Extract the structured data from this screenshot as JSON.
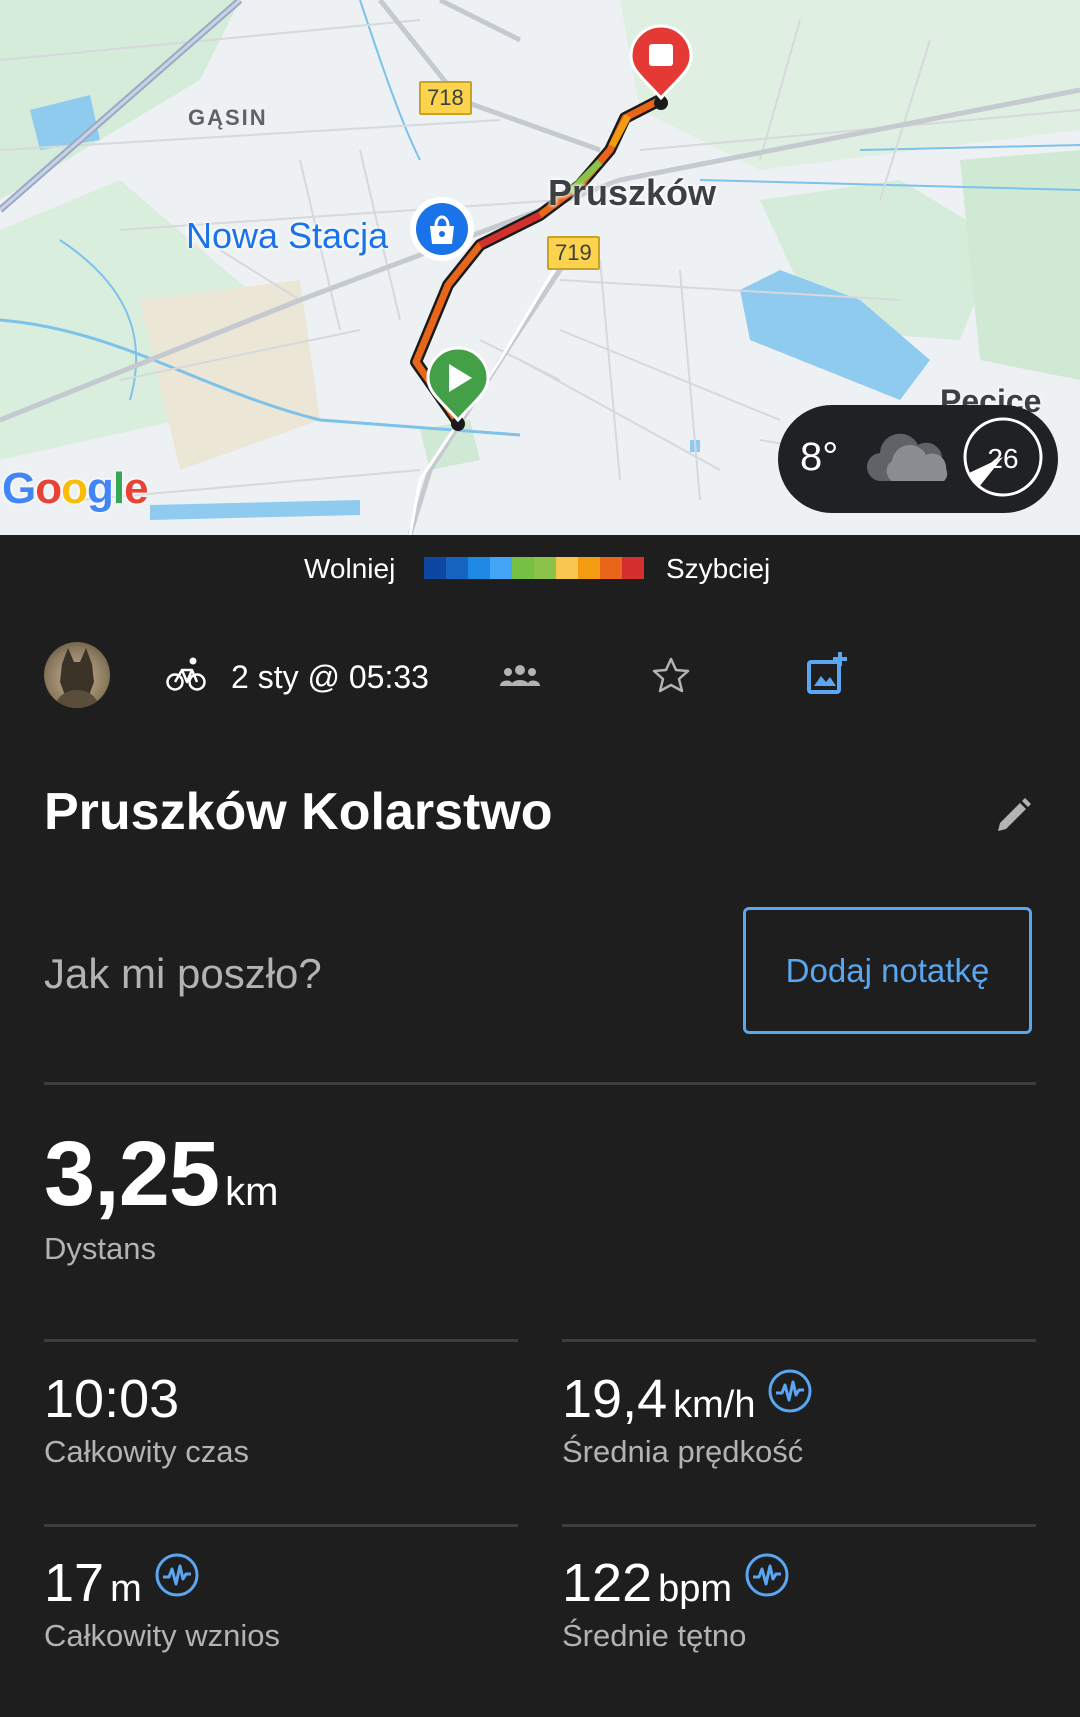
{
  "map": {
    "district_label": "GĄSIN",
    "city_label": "Pruszków",
    "poi_label": "Nowa Stacja",
    "edge_label": "Pęcice",
    "road_shields": [
      "718",
      "719"
    ],
    "logo_text": "Google",
    "weather": {
      "temperature": "8°",
      "condition_icon": "cloud-icon",
      "wind_value": "26"
    },
    "colors": {
      "route_slow": "#1565c0",
      "route_fast": "#d32f2f",
      "start_pin": "#43a047",
      "end_pin": "#e53935",
      "poi_pin": "#1a73e8"
    }
  },
  "legend": {
    "slow_label": "Wolniej",
    "fast_label": "Szybciej",
    "colors": [
      "#0d47a1",
      "#1565c0",
      "#1e88e5",
      "#42a5f5",
      "#76c043",
      "#8bc34a",
      "#f9c74f",
      "#f39c12",
      "#e8651a",
      "#d32f2f"
    ]
  },
  "activity": {
    "avatar_icon": "avatar",
    "sport_icon": "bike-icon",
    "date": "2 sty @ 05:33",
    "title": "Pruszków Kolarstwo",
    "note_prompt": "Jak mi poszło?",
    "add_note_label": "Dodaj notatkę",
    "accent_color": "#5aa6f0"
  },
  "stats": {
    "distance": {
      "value": "3,25",
      "unit": "km",
      "label": "Dystans"
    },
    "total_time": {
      "value": "10:03",
      "unit": "",
      "label": "Całkowity czas"
    },
    "avg_speed": {
      "value": "19,4",
      "unit": "km/h",
      "label": "Średnia prędkość"
    },
    "elevation": {
      "value": "17",
      "unit": "m",
      "label": "Całkowity wznios"
    },
    "avg_hr": {
      "value": "122",
      "unit": "bpm",
      "label": "Średnie tętno"
    }
  }
}
